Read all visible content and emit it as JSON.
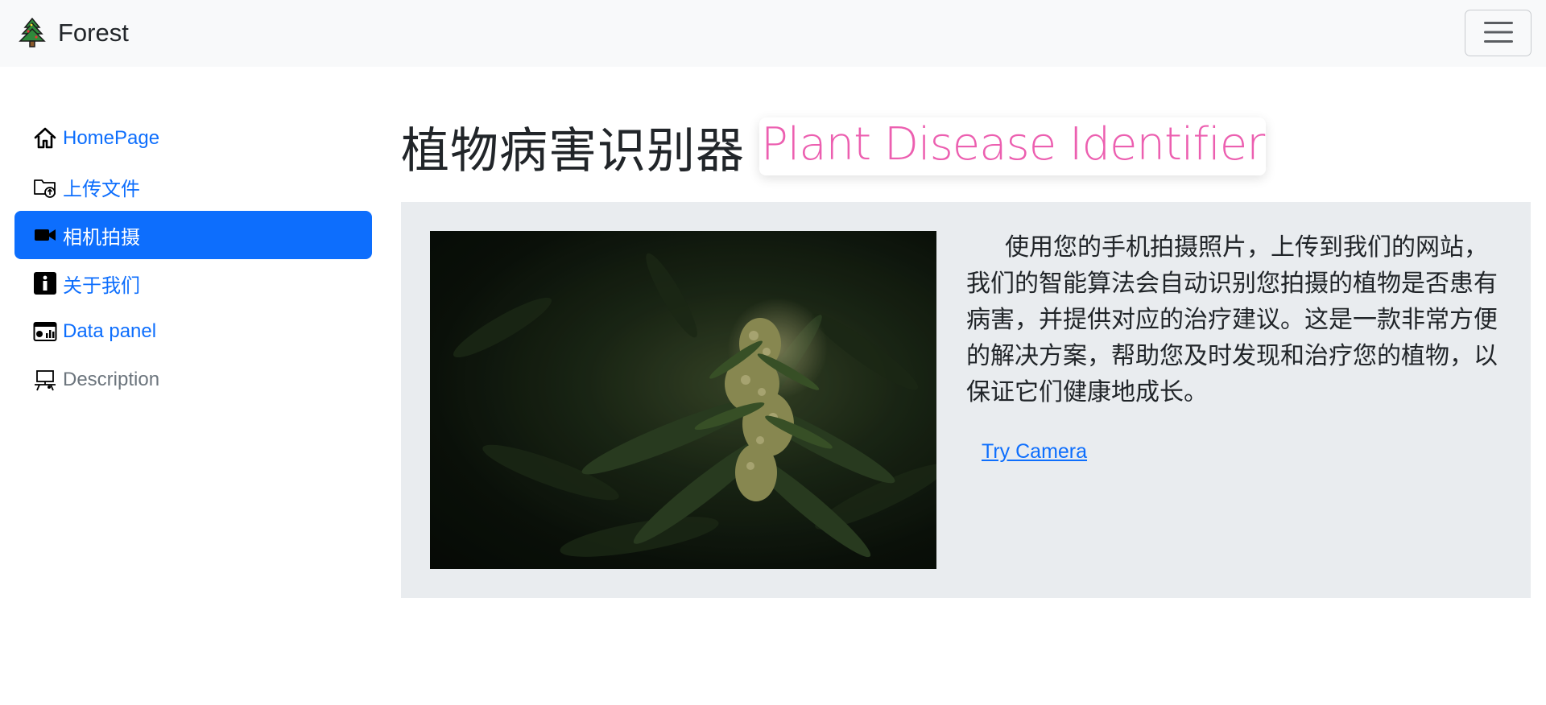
{
  "navbar": {
    "brand": "Forest",
    "brand_icon": "pine-tree-icon",
    "toggler_icon": "hamburger-menu-icon"
  },
  "sidebar": {
    "items": [
      {
        "label": "HomePage",
        "icon": "home-icon",
        "active": false
      },
      {
        "label": "上传文件",
        "icon": "folder-upload-icon",
        "active": false
      },
      {
        "label": "相机拍摄",
        "icon": "video-camera-icon",
        "active": true
      },
      {
        "label": "关于我们",
        "icon": "info-icon",
        "active": false
      },
      {
        "label": "Data panel",
        "icon": "dashboard-icon",
        "active": false
      },
      {
        "label": "Description",
        "icon": "projector-icon",
        "active": false,
        "muted": true
      }
    ]
  },
  "main": {
    "title_zh": "植物病害识别器",
    "title_en": "Plant Disease Identifier",
    "description": "使用您的手机拍摄照片，上传到我们的网站，我们的智能算法会自动识别您拍摄的植物是否患有病害，并提供对应的治疗建议。这是一款非常方便的解决方案，帮助您及时发现和治疗您的植物，以保证它们健康地成长。",
    "try_link": "Try Camera"
  },
  "colors": {
    "accent": "#0d6efd",
    "title_en": "#ec5fb0",
    "panel_bg": "#e9ecef",
    "navbar_bg": "#f8f9fa"
  }
}
